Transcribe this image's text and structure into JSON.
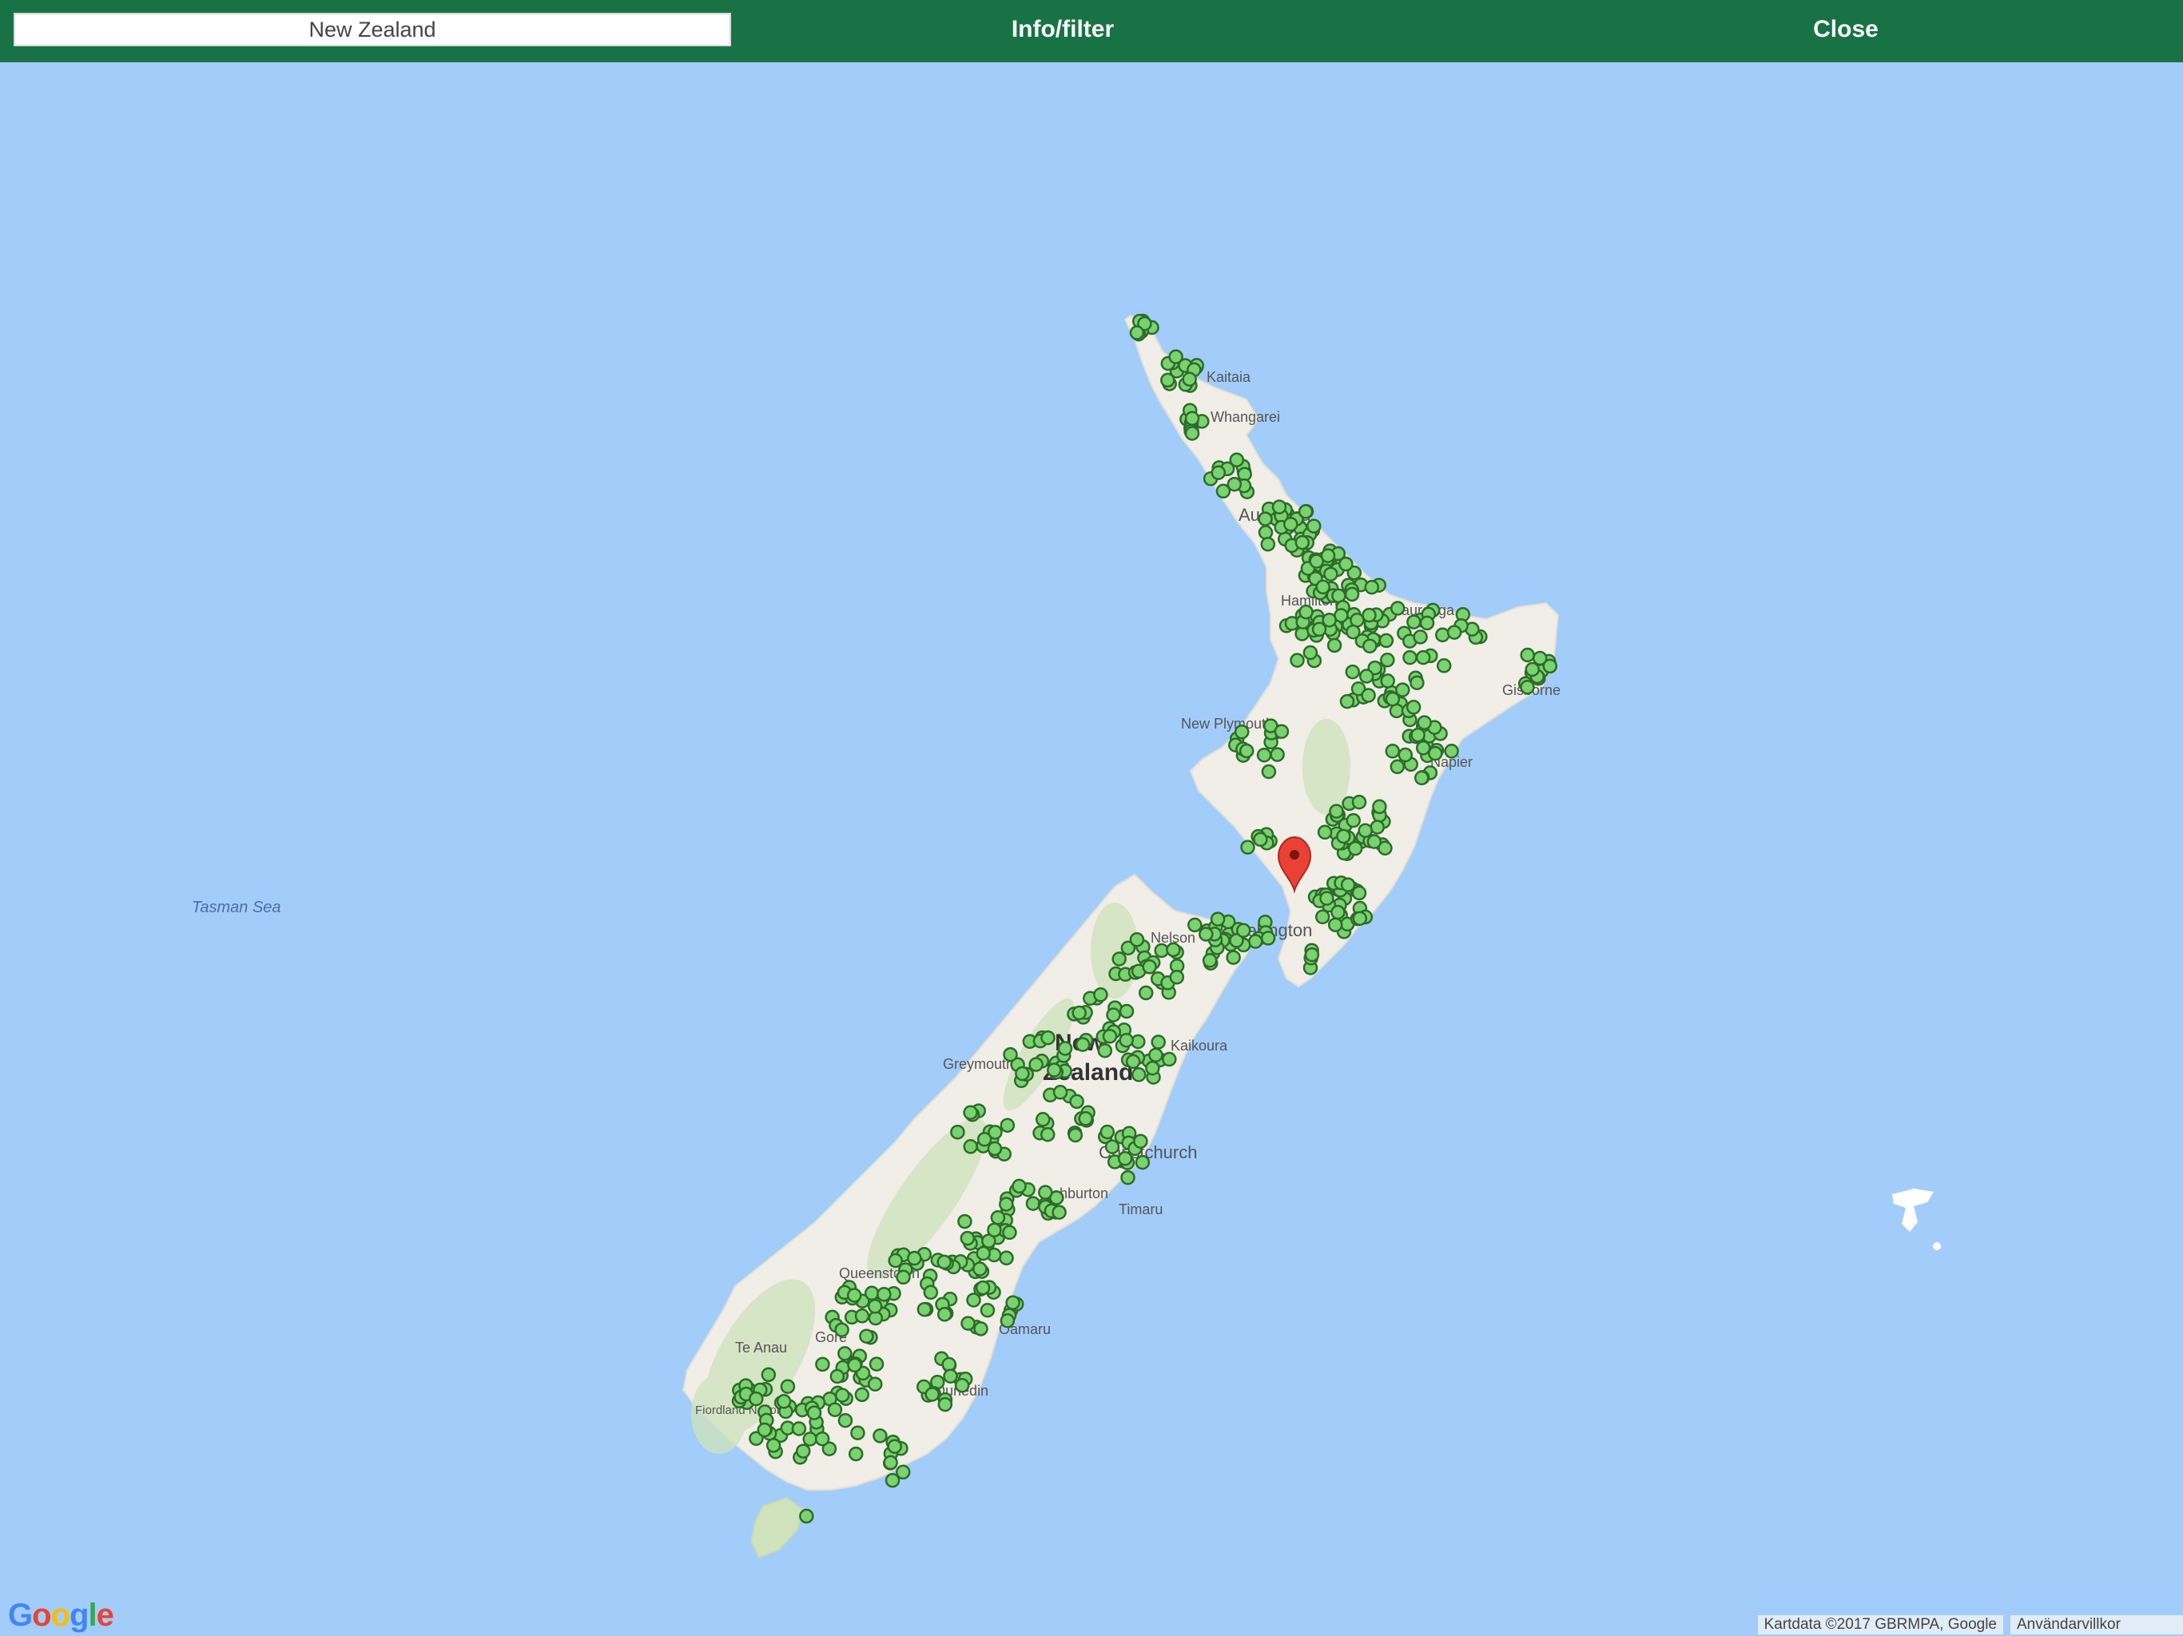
{
  "toolbar": {
    "search_value": "New Zealand",
    "info_label": "Info/filter",
    "close_label": "Close",
    "accent_color": "#187245"
  },
  "map": {
    "sea_color": "#a2cdfb",
    "land_color": "#f0eee7",
    "labels": {
      "tasman_sea": "Tasman Sea",
      "country": [
        "New",
        "Zealand"
      ],
      "kaitaia": "Kaitaia",
      "whangarei": "Whangarei",
      "auckland": "Auckland",
      "hamilton": "Hamilton",
      "tauranga": "Tauranga",
      "gisborne": "Gisborne",
      "new_plymouth": "New Plymouth",
      "napier": "Napier",
      "wellington": "Wellington",
      "nelson": "Nelson",
      "kaikoura": "Kaikoura",
      "greymouth": "Greymouth",
      "christchurch": "Christchurch",
      "ashburton": "Ashburton",
      "timaru": "Timaru",
      "oamaru": "Oamaru",
      "queenstown": "Queenstown",
      "te_anau": "Te Anau",
      "dunedin": "Dunedin",
      "fiordland": "Fiordland National Park",
      "gore": "Gore"
    },
    "marker_color": "#79d36f",
    "pin_color": "#e94235"
  },
  "footer": {
    "logo": [
      "G",
      "o",
      "o",
      "g",
      "l",
      "e"
    ],
    "attribution": "Kartdata ©2017 GBRMPA, Google",
    "terms": "Användarvillkor"
  }
}
